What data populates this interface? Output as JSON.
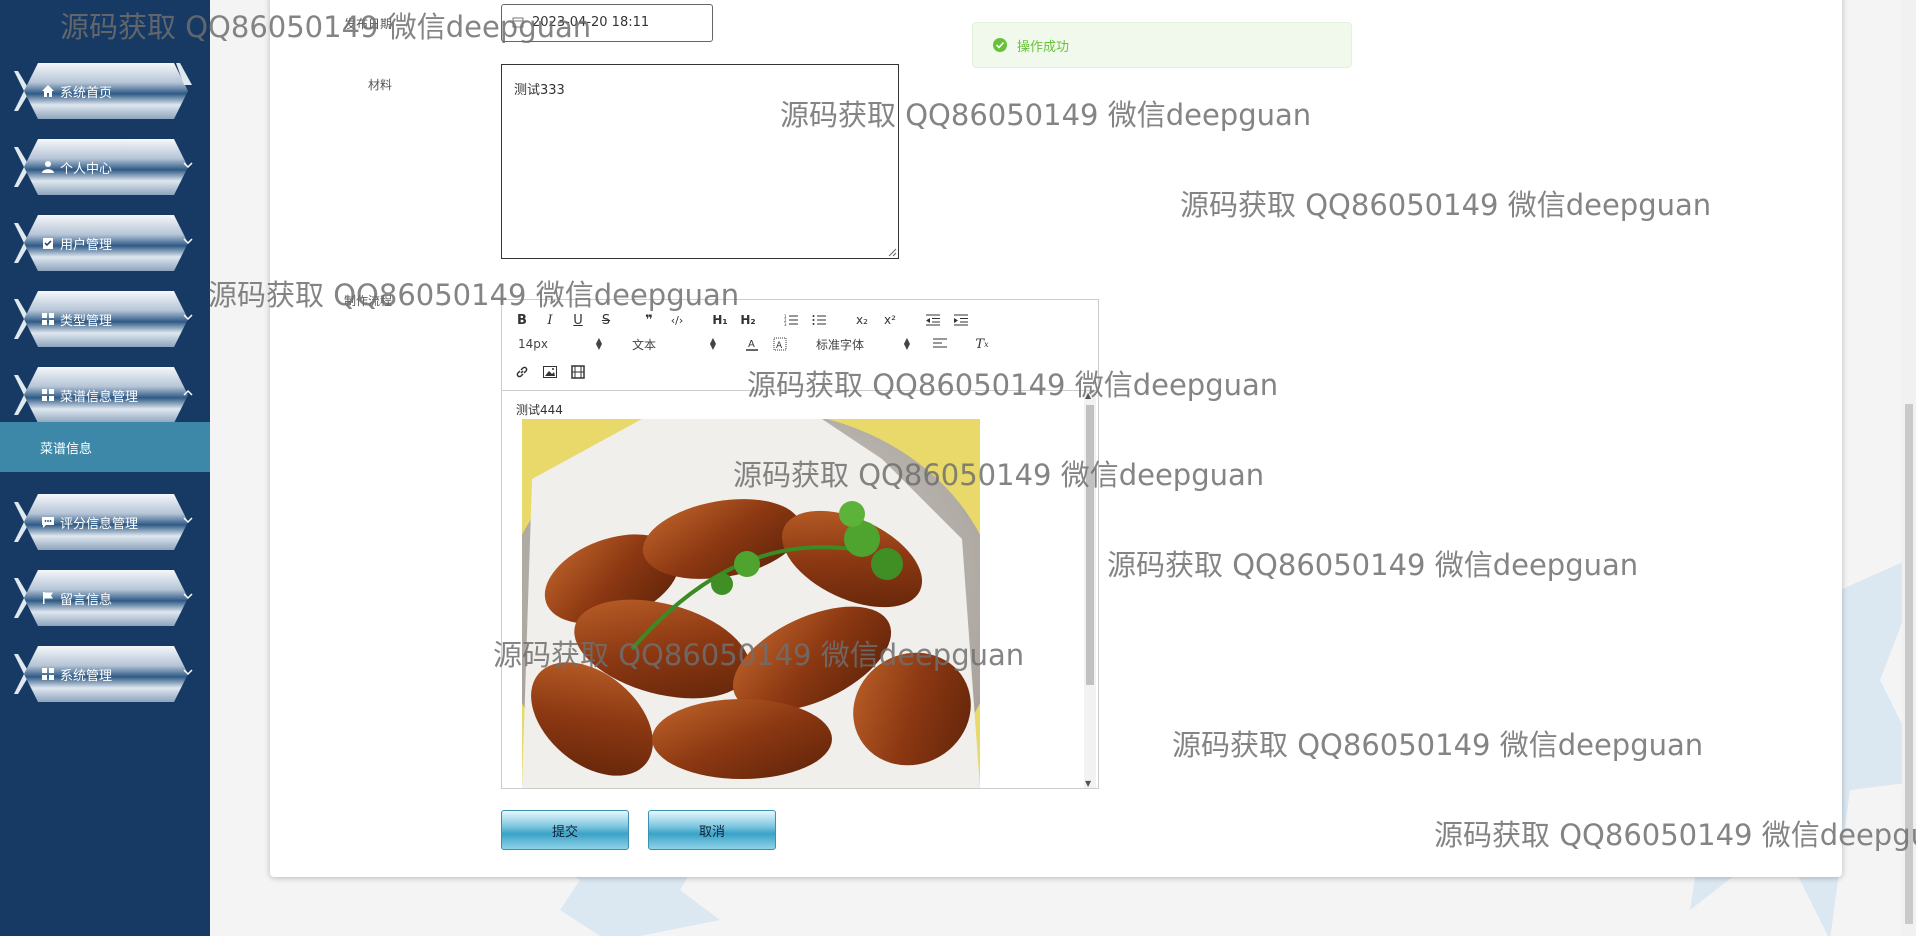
{
  "sidebar": {
    "items": [
      {
        "label": "系统首页",
        "icon": "home-icon",
        "expanded": null
      },
      {
        "label": "个人中心",
        "icon": "user-icon",
        "expanded": false
      },
      {
        "label": "用户管理",
        "icon": "clipboard-check-icon",
        "expanded": false
      },
      {
        "label": "类型管理",
        "icon": "grid-icon",
        "expanded": false
      },
      {
        "label": "菜谱信息管理",
        "icon": "grid-icon",
        "expanded": true
      },
      {
        "label": "评分信息管理",
        "icon": "comment-icon",
        "expanded": false
      },
      {
        "label": "留言信息",
        "icon": "flag-icon",
        "expanded": false
      },
      {
        "label": "系统管理",
        "icon": "grid-icon",
        "expanded": false
      }
    ],
    "submenu": {
      "label": "菜谱信息"
    }
  },
  "form": {
    "date_label": "发布日期",
    "date_value": "2023-04-20 18:11",
    "material_label": "材料",
    "material_value": "测试333",
    "process_label": "制作流程",
    "editor": {
      "font_size": "14px",
      "block_type": "文本",
      "font_family": "标准字体",
      "content_text": "测试444"
    },
    "submit_label": "提交",
    "cancel_label": "取消"
  },
  "toast": {
    "message": "操作成功"
  },
  "watermark": "源码获取 QQ86050149 微信deepguan",
  "colors": {
    "sidebar_bg": "#163a63",
    "submenu_active_bg": "#3d88a8",
    "toast_bg": "#f0f9eb",
    "toast_text": "#67c23a",
    "button_blue": "#3aa3c8"
  }
}
